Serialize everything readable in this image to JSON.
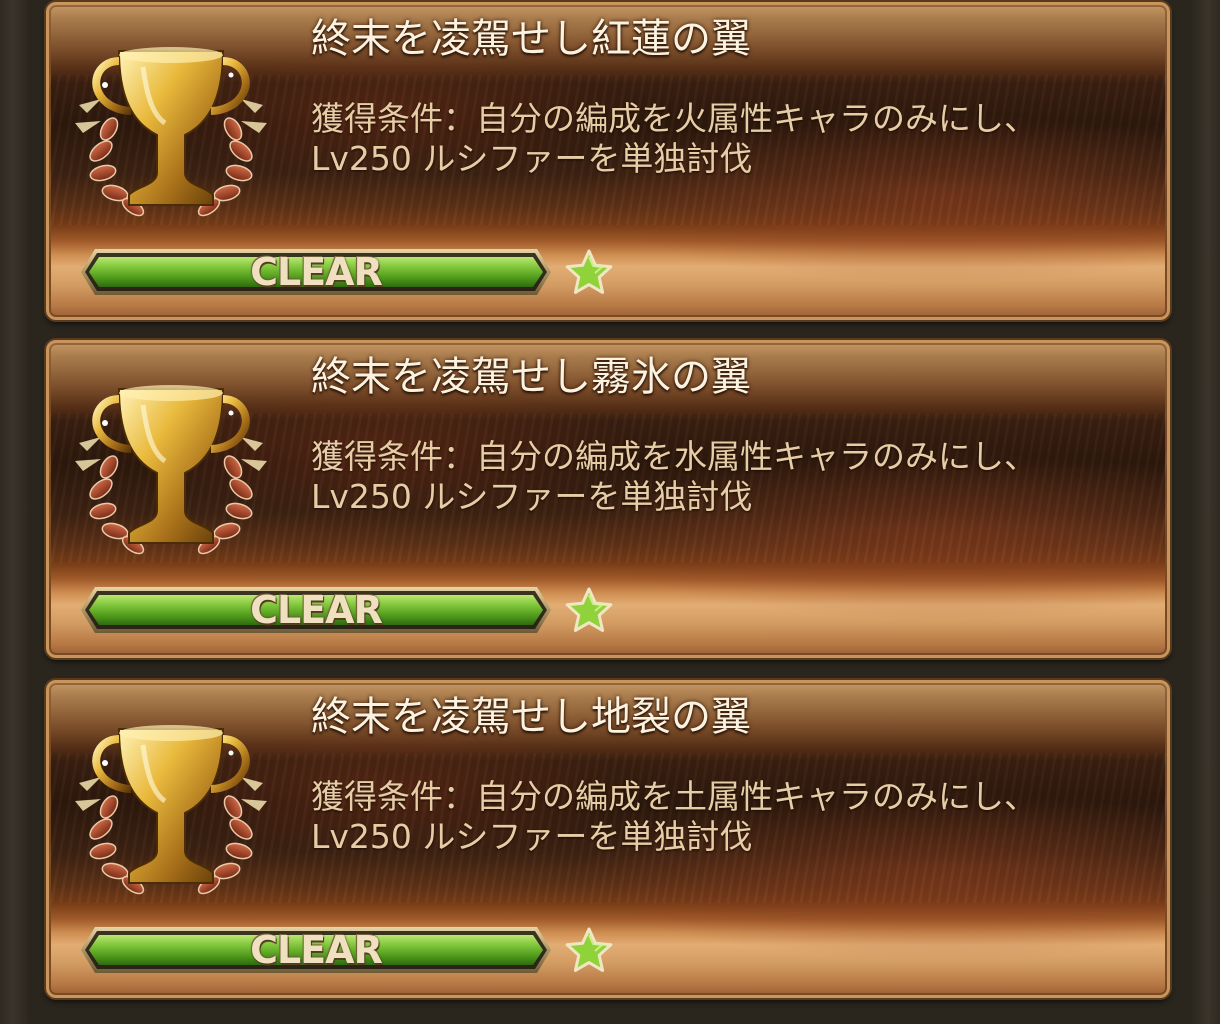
{
  "trophies": [
    {
      "title": "終末を凌駕せし紅蓮の翼",
      "description_line1": "獲得条件：自分の編成を火属性キャラのみにし、",
      "description_line2": "Lv250 ルシファーを単独討伐",
      "status": "CLEAR",
      "progress": 1.0,
      "badge_icon": "star-icon",
      "trophy_icon": "trophy-cup-icon"
    },
    {
      "title": "終末を凌駕せし霧氷の翼",
      "description_line1": "獲得条件：自分の編成を水属性キャラのみにし、",
      "description_line2": "Lv250 ルシファーを単独討伐",
      "status": "CLEAR",
      "progress": 1.0,
      "badge_icon": "star-icon",
      "trophy_icon": "trophy-cup-icon"
    },
    {
      "title": "終末を凌駕せし地裂の翼",
      "description_line1": "獲得条件：自分の編成を土属性キャラのみにし、",
      "description_line2": "Lv250 ルシファーを単独討伐",
      "status": "CLEAR",
      "progress": 1.0,
      "badge_icon": "star-icon",
      "trophy_icon": "trophy-cup-icon"
    }
  ],
  "colors": {
    "title_text": "#fbf3e0",
    "description_text": "#e7cda6",
    "progress_fill": "#7fc43a",
    "card_border": "#c9955c",
    "star_fill": "#8fd23a"
  }
}
